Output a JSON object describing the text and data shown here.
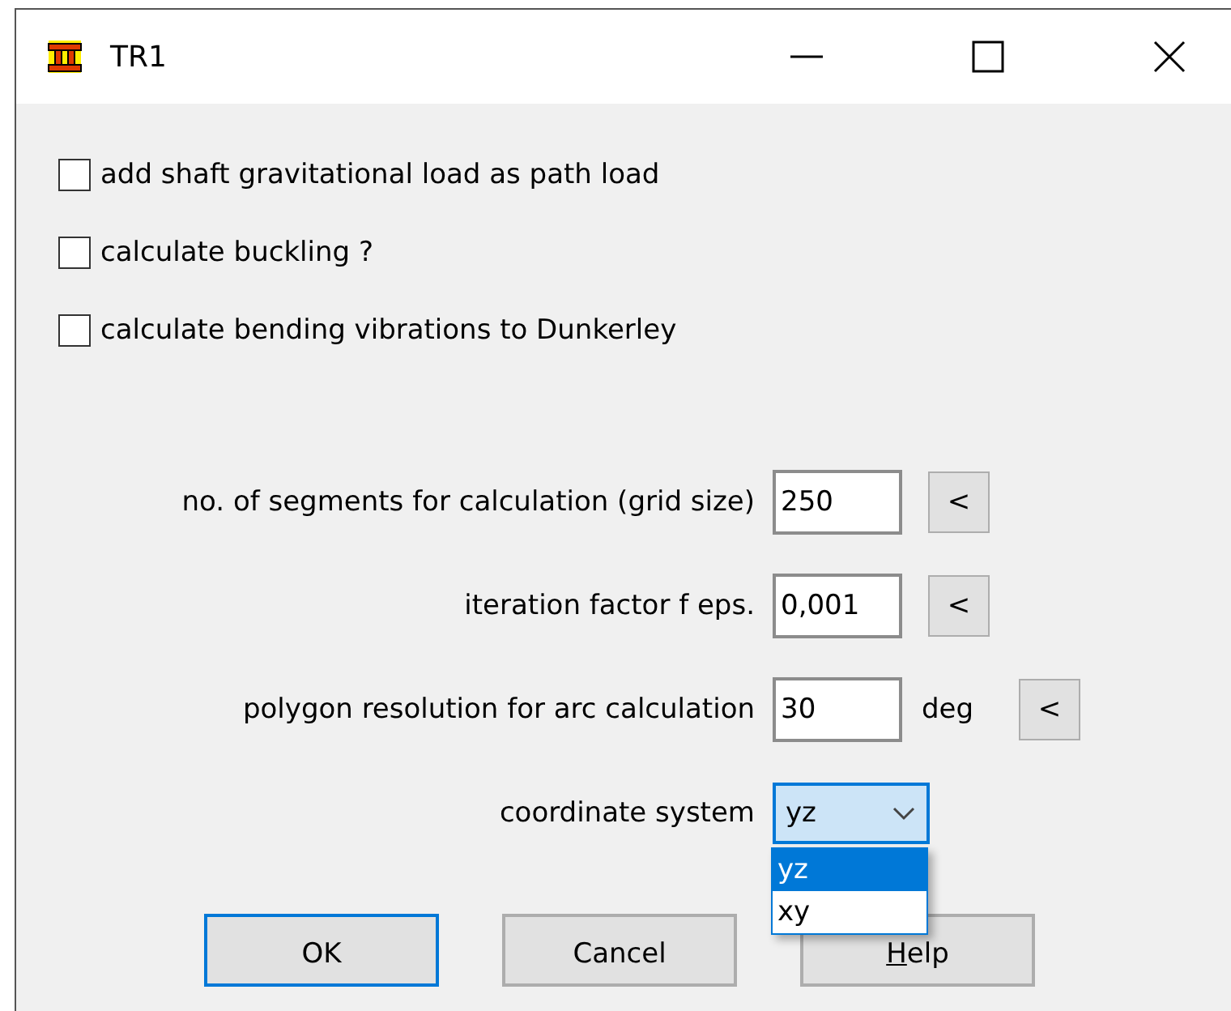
{
  "window": {
    "title": "TR1"
  },
  "checkboxes": [
    {
      "label": "add shaft gravitational load as path load",
      "checked": false
    },
    {
      "label": "calculate buckling ?",
      "checked": false
    },
    {
      "label": "calculate bending vibrations to Dunkerley",
      "checked": false
    }
  ],
  "fields": [
    {
      "label": "no. of segments for calculation (grid size)",
      "value": "250",
      "button": "<"
    },
    {
      "label": "iteration factor f eps.",
      "value": "0,001",
      "button": "<"
    },
    {
      "label": "polygon resolution for arc calculation",
      "value": "30",
      "unit": "deg",
      "button": "<"
    }
  ],
  "coordinate_system": {
    "label": "coordinate system",
    "value": "yz",
    "expanded": true,
    "options": [
      {
        "label": "yz",
        "selected": true
      },
      {
        "label": "xy",
        "selected": false
      }
    ]
  },
  "buttons": [
    {
      "label": "OK",
      "focused": true
    },
    {
      "label": "Cancel",
      "focused": false
    },
    {
      "label": "Help",
      "focused": false
    }
  ]
}
